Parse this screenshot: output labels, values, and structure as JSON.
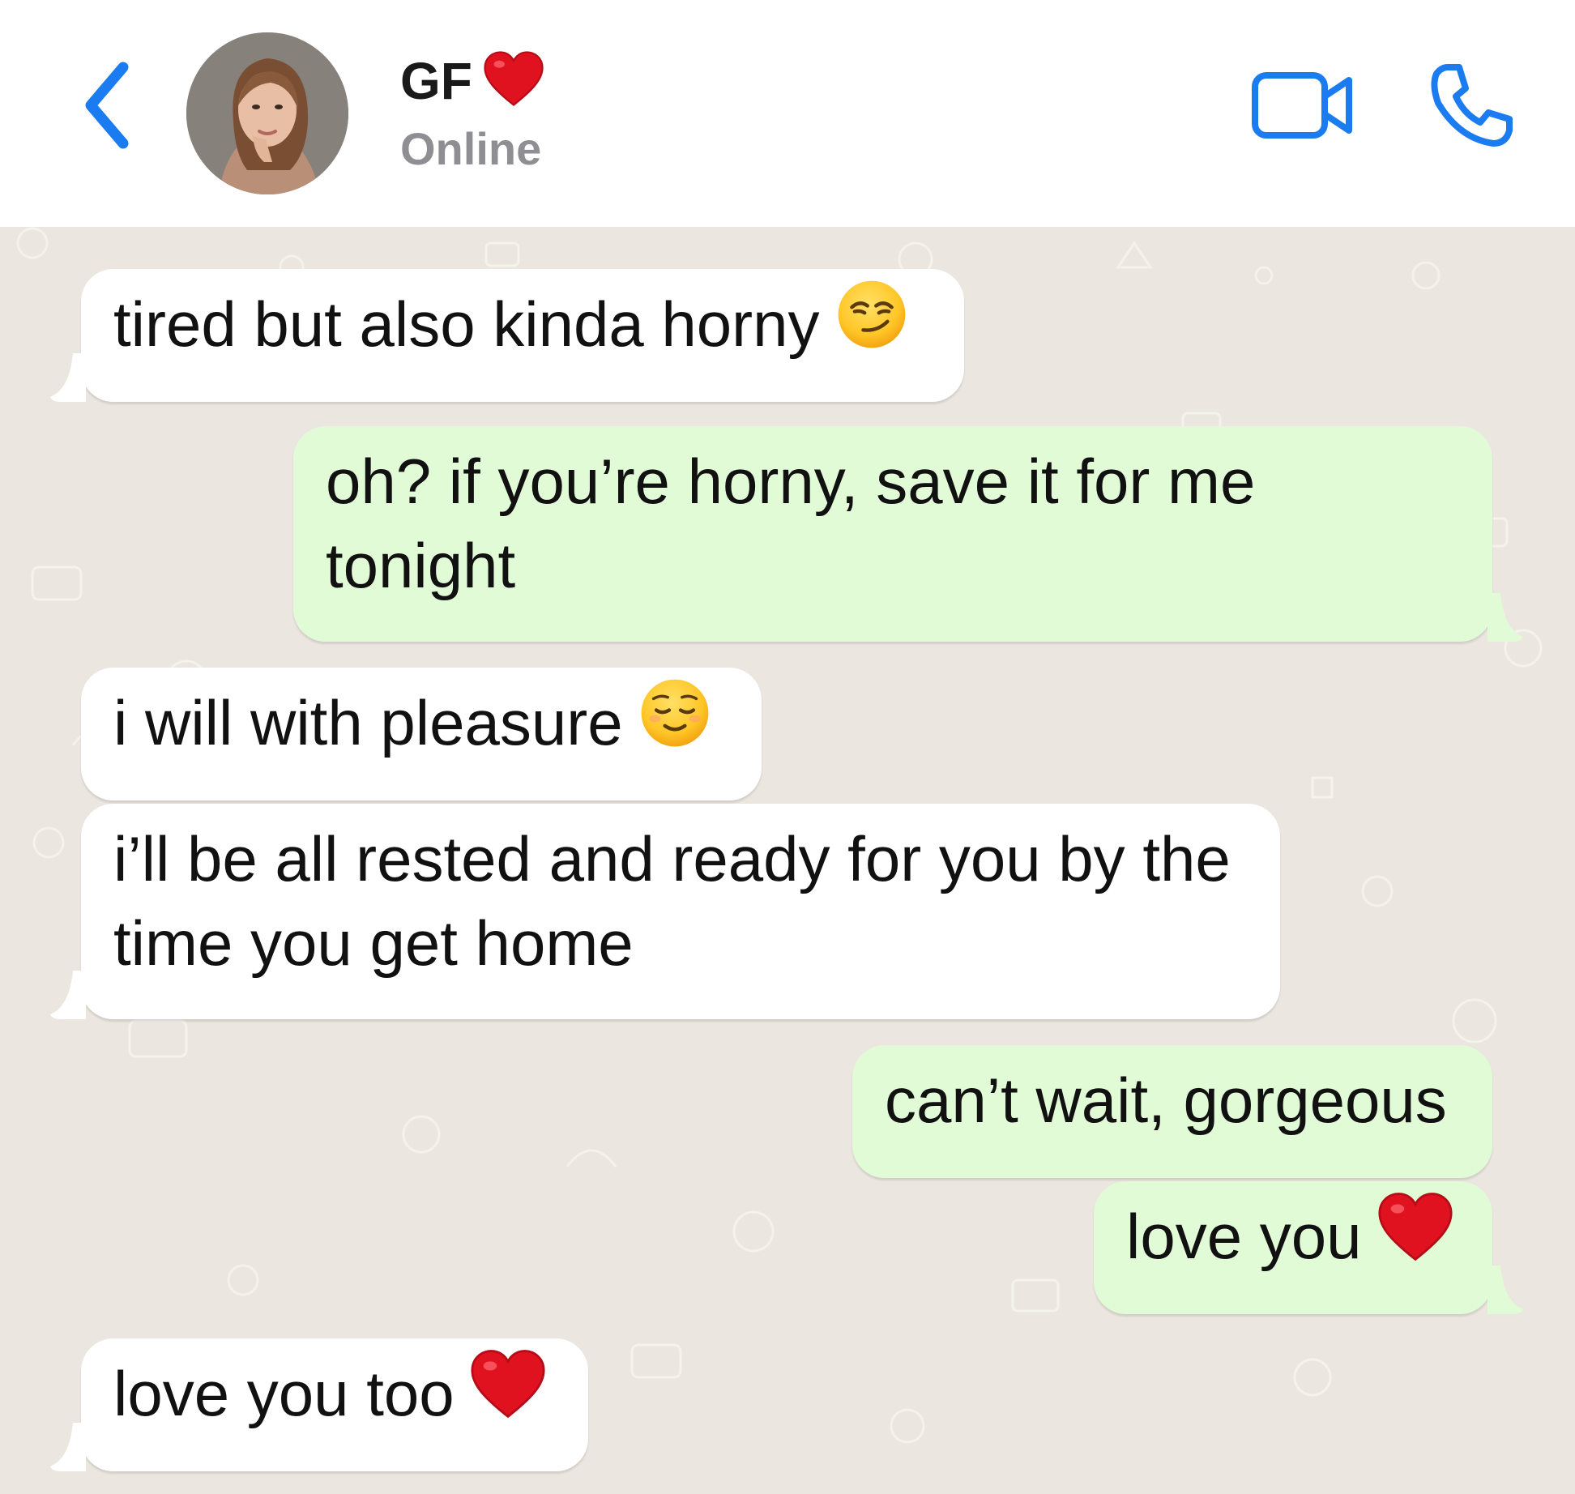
{
  "header": {
    "contact_name": "GF",
    "contact_status": "Online"
  },
  "icons": {
    "back": "chevron-left-icon",
    "video": "video-camera-icon",
    "call": "phone-icon",
    "name_emoji": "red-heart-emoji"
  },
  "colors": {
    "accent": "#1a7cf0",
    "incoming_bubble": "#ffffff",
    "outgoing_bubble": "#e2fbd7",
    "chat_background": "#ebe6df",
    "status_text": "#8e8e93"
  },
  "messages": [
    {
      "direction": "incoming",
      "text": "tired but also kinda horny",
      "emoji": "smirking-face"
    },
    {
      "direction": "outgoing",
      "text": "oh? if you’re horny, save it for me tonight",
      "emoji": ""
    },
    {
      "direction": "incoming",
      "text": "i will with pleasure",
      "emoji": "relieved-face"
    },
    {
      "direction": "incoming",
      "text": "i’ll be all rested and ready for you by the time you get home",
      "emoji": ""
    },
    {
      "direction": "outgoing",
      "text": "can’t wait, gorgeous",
      "emoji": ""
    },
    {
      "direction": "outgoing",
      "text": "love you",
      "emoji": "red-heart"
    },
    {
      "direction": "incoming",
      "text": "love you too",
      "emoji": "red-heart"
    }
  ]
}
